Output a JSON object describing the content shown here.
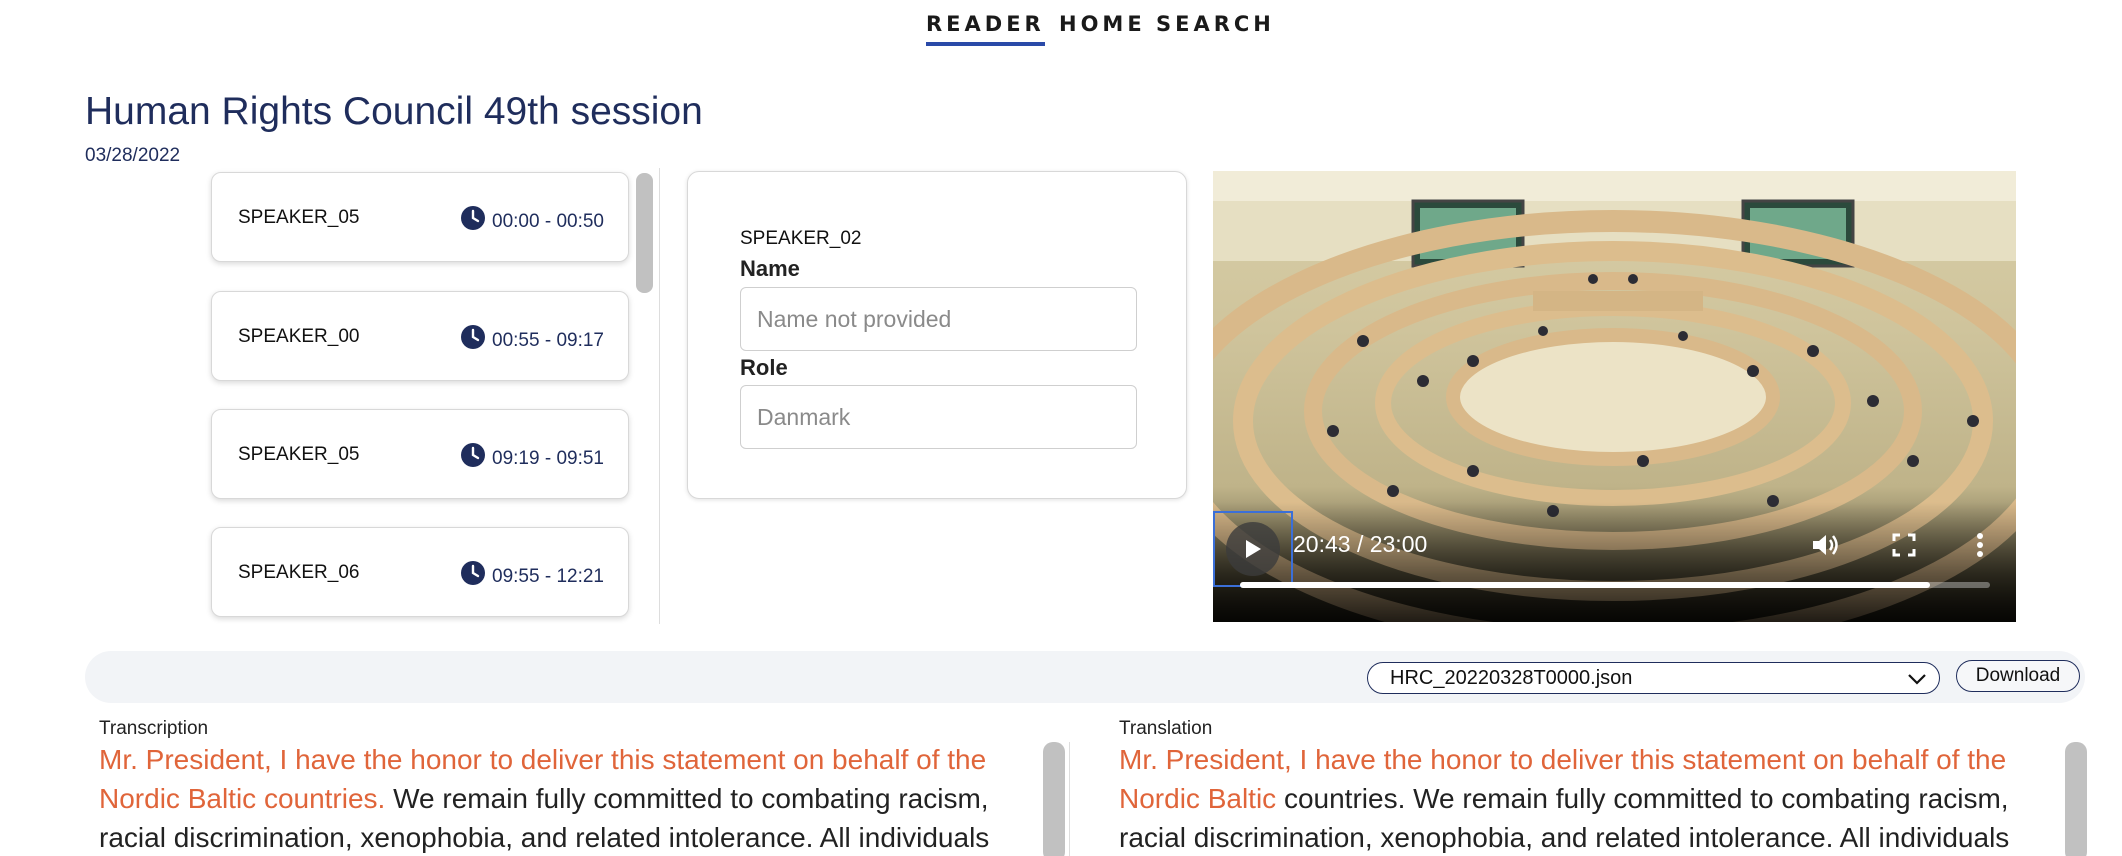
{
  "nav": {
    "reader": "READER",
    "home": "HOME",
    "search": "SEARCH"
  },
  "page": {
    "title": "Human Rights Council 49th session",
    "date": "03/28/2022"
  },
  "speakers": [
    {
      "name": "SPEAKER_05",
      "time": "00:00 - 00:50"
    },
    {
      "name": "SPEAKER_00",
      "time": "00:55 - 09:17"
    },
    {
      "name": "SPEAKER_05",
      "time": "09:19 - 09:51"
    },
    {
      "name": "SPEAKER_06",
      "time": "09:55 - 12:21"
    }
  ],
  "detail": {
    "speaker": "SPEAKER_02",
    "name_label": "Name",
    "name_placeholder": "Name not provided",
    "role_label": "Role",
    "role_placeholder": "Danmark"
  },
  "video": {
    "time": "20:43 / 23:00",
    "progress_fraction": 0.92,
    "icons": [
      "play-icon",
      "volume-icon",
      "fullscreen-icon",
      "more-options-icon"
    ]
  },
  "toolbar": {
    "file": "HRC_20220328T0000.json",
    "download": "Download"
  },
  "transcription": {
    "label": "Transcription",
    "highlight": "Mr. President, I have the honor to deliver this statement on behalf of the Nordic Baltic countries.",
    "rest": " We remain fully committed to combating racism, racial discrimination, xenophobia, and related intolerance. All individuals must be"
  },
  "translation": {
    "label": "Translation",
    "highlight": "Mr. President, I have the honor to deliver this statement on behalf of the Nordic Baltic",
    "rest": " countries. We remain fully committed to combating racism, racial discrimination, xenophobia, and related intolerance. All individuals must be"
  },
  "colors": {
    "accent": "#2a4aa8",
    "title": "#1f2d5c",
    "highlight": "#e0653a"
  }
}
